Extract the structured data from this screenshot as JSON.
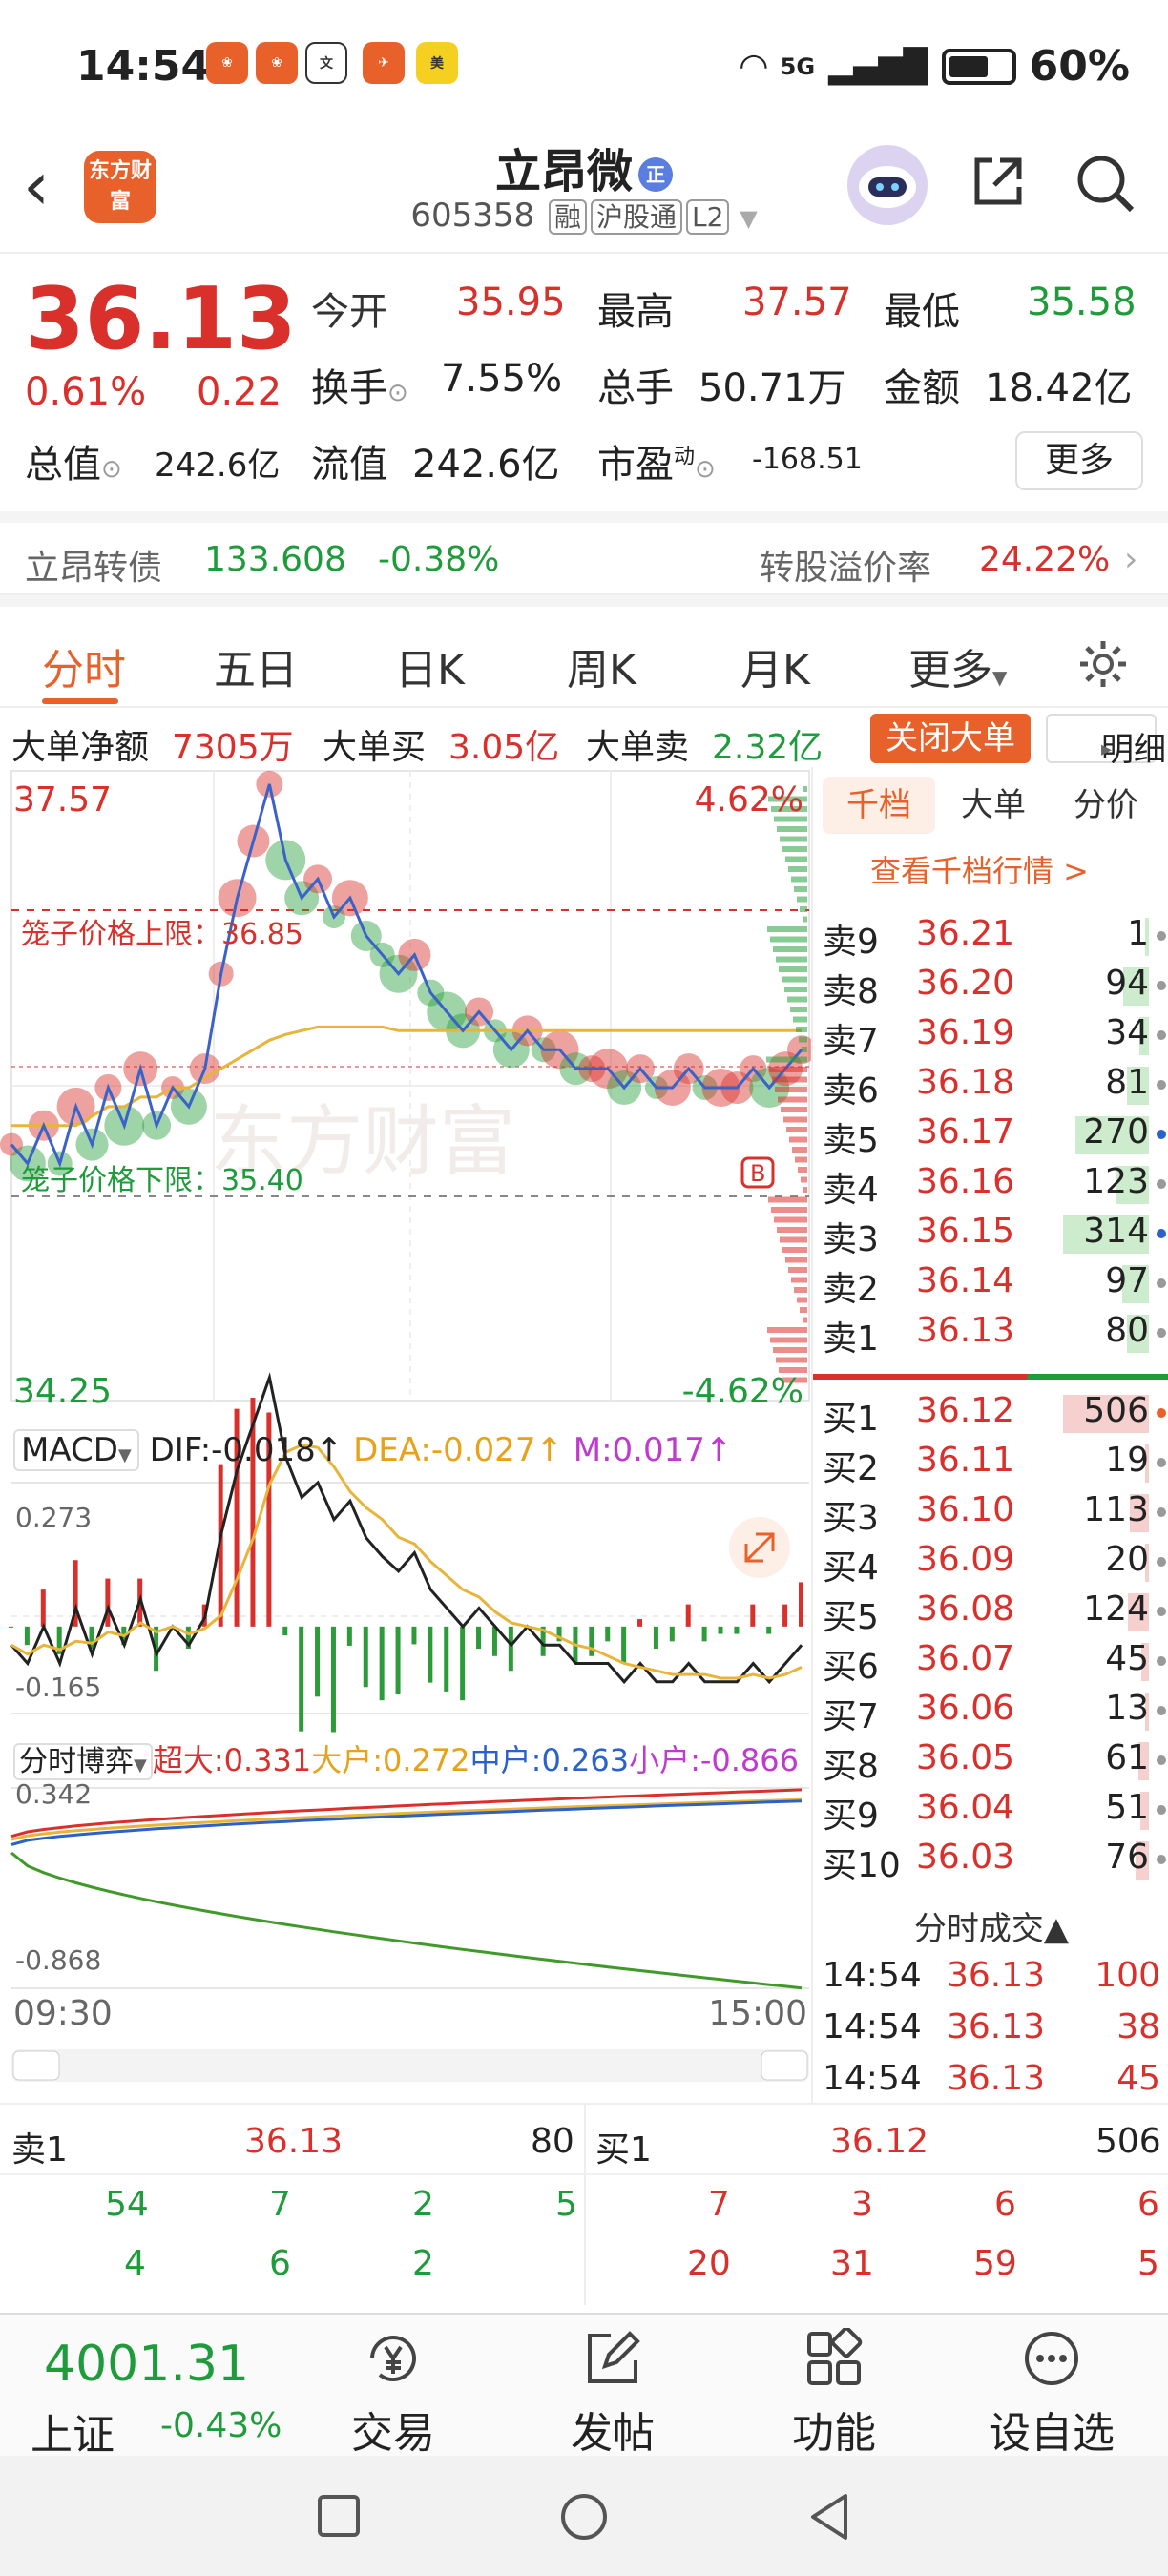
{
  "status_bar": {
    "time": "14:54",
    "signal": "5G",
    "battery": "60%"
  },
  "header": {
    "back_icon": "chevron-left-icon",
    "logo_text": "东方财富",
    "stock_name": "立昂微",
    "zheng_badge": "正",
    "stock_code": "605358",
    "tags": [
      "融",
      "沪股通",
      "L2"
    ]
  },
  "quote": {
    "price": "36.13",
    "pct": "0.61%",
    "change": "0.22",
    "open_label": "今开",
    "open": "35.95",
    "high_label": "最高",
    "high": "37.57",
    "low_label": "最低",
    "low": "35.58",
    "turnover_label": "换手",
    "turnover": "7.55%",
    "volume_label": "总手",
    "volume": "50.71万",
    "amount_label": "金额",
    "amount": "18.42亿",
    "mktcap_label": "总值",
    "mktcap": "242.6亿",
    "float_label": "流值",
    "float": "242.6亿",
    "pe_label": "市盈",
    "pe_sup": "动",
    "pe": "-168.51",
    "more_label": "更多"
  },
  "bond": {
    "name": "立昂转债",
    "price": "133.608",
    "pct": "-0.38%",
    "premium_label": "转股溢价率",
    "premium": "24.22%"
  },
  "tabs": {
    "items": [
      "分时",
      "五日",
      "日K",
      "周K",
      "月K",
      "更多"
    ],
    "active": 0
  },
  "bigorder": {
    "net_label": "大单净额",
    "net": "7305万",
    "buy_label": "大单买",
    "buy": "3.05亿",
    "sell_label": "大单卖",
    "sell": "2.32亿",
    "close_label": "关闭大单",
    "detail_label": "明细"
  },
  "chart": {
    "top_price": "37.57",
    "top_pct": "4.62%",
    "bottom_price": "34.25",
    "bottom_pct": "-4.62%",
    "upper_label": "笼子价格上限：36.85",
    "lower_label": "笼子价格下限：35.40",
    "b_marker": "B",
    "watermark": "东方财富",
    "price_series": [
      35.6,
      35.5,
      35.7,
      35.5,
      35.8,
      35.6,
      35.9,
      35.7,
      36.0,
      35.7,
      35.9,
      35.8,
      36.0,
      36.5,
      36.9,
      37.2,
      37.5,
      37.1,
      36.9,
      37.0,
      36.8,
      36.9,
      36.7,
      36.6,
      36.5,
      36.6,
      36.4,
      36.3,
      36.2,
      36.3,
      36.2,
      36.1,
      36.2,
      36.1,
      36.1,
      36.0,
      36.0,
      36.0,
      35.9,
      36.0,
      35.9,
      35.9,
      36.0,
      35.9,
      35.9,
      35.9,
      36.0,
      35.9,
      36.0,
      36.1
    ],
    "avg_series": [
      35.7,
      35.7,
      35.7,
      35.7,
      35.7,
      35.75,
      35.8,
      35.8,
      35.85,
      35.85,
      35.9,
      35.9,
      35.95,
      36.0,
      36.05,
      36.1,
      36.15,
      36.18,
      36.2,
      36.22,
      36.22,
      36.22,
      36.22,
      36.22,
      36.2,
      36.2,
      36.2,
      36.2,
      36.2,
      36.2,
      36.2,
      36.2,
      36.2,
      36.2,
      36.2,
      36.2,
      36.2,
      36.2,
      36.2,
      36.2,
      36.2,
      36.2,
      36.2,
      36.2,
      36.2,
      36.2,
      36.2,
      36.2,
      36.2,
      36.2
    ],
    "macd_label": "MACD",
    "dif": "DIF:-0.018↑",
    "dea": "DEA:-0.027↑",
    "m": "M:0.017↑",
    "macd_top": "0.273",
    "macd_bottom": "-0.165",
    "game_label": "分时博弈",
    "super": "超大:0.331",
    "big": "大户:0.272",
    "mid": "中户:0.263",
    "small": "小户:-0.866",
    "game_top": "0.342",
    "game_bottom": "-0.868",
    "time_start": "09:30",
    "time_end": "15:00"
  },
  "book": {
    "tabs": [
      "千档",
      "大单",
      "分价"
    ],
    "view_all": "查看千档行情 >",
    "asks": [
      {
        "label": "卖9",
        "price": "36.21",
        "vol": "1"
      },
      {
        "label": "卖8",
        "price": "36.20",
        "vol": "94"
      },
      {
        "label": "卖7",
        "price": "36.19",
        "vol": "34"
      },
      {
        "label": "卖6",
        "price": "36.18",
        "vol": "81"
      },
      {
        "label": "卖5",
        "price": "36.17",
        "vol": "270"
      },
      {
        "label": "卖4",
        "price": "36.16",
        "vol": "123"
      },
      {
        "label": "卖3",
        "price": "36.15",
        "vol": "314"
      },
      {
        "label": "卖2",
        "price": "36.14",
        "vol": "97"
      },
      {
        "label": "卖1",
        "price": "36.13",
        "vol": "80"
      }
    ],
    "bids": [
      {
        "label": "买1",
        "price": "36.12",
        "vol": "506"
      },
      {
        "label": "买2",
        "price": "36.11",
        "vol": "19"
      },
      {
        "label": "买3",
        "price": "36.10",
        "vol": "113"
      },
      {
        "label": "买4",
        "price": "36.09",
        "vol": "20"
      },
      {
        "label": "买5",
        "price": "36.08",
        "vol": "124"
      },
      {
        "label": "买6",
        "price": "36.07",
        "vol": "45"
      },
      {
        "label": "买7",
        "price": "36.06",
        "vol": "13"
      },
      {
        "label": "买8",
        "price": "36.05",
        "vol": "61"
      },
      {
        "label": "买9",
        "price": "36.04",
        "vol": "51"
      },
      {
        "label": "买10",
        "price": "36.03",
        "vol": "76"
      }
    ],
    "trades_head": "分时成交▲",
    "trades": [
      {
        "time": "14:54",
        "price": "36.13",
        "vol": "100"
      },
      {
        "time": "14:54",
        "price": "36.13",
        "vol": "38"
      },
      {
        "time": "14:54",
        "price": "36.13",
        "vol": "45"
      }
    ]
  },
  "depth": {
    "sell_label": "卖1",
    "sell_price": "36.13",
    "sell_vol": "80",
    "buy_label": "买1",
    "buy_price": "36.12",
    "buy_vol": "506",
    "sell_row1": [
      "54",
      "7",
      "2",
      "5"
    ],
    "sell_row2": [
      "4",
      "6",
      "2"
    ],
    "buy_row1": [
      "7",
      "3",
      "6",
      "6"
    ],
    "buy_row2": [
      "20",
      "31",
      "59",
      "5"
    ]
  },
  "bottom": {
    "index_value": "4001.31",
    "index_name": "上证",
    "index_pct": "-0.43%",
    "nav": [
      {
        "label": "交易",
        "icon": "yen-icon"
      },
      {
        "label": "发帖",
        "icon": "edit-icon"
      },
      {
        "label": "功能",
        "icon": "grid-icon"
      },
      {
        "label": "设自选",
        "icon": "more-icon"
      }
    ]
  }
}
